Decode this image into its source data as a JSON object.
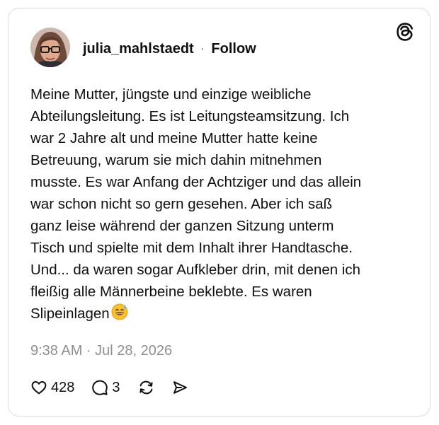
{
  "post": {
    "username": "julia_mahlstaedt",
    "separator": "·",
    "follow_label": "Follow",
    "text_lines": [
      "Meine Mutter, jüngste und einzige weibliche",
      "Abteilungsleitung. Es ist Leitungsteamsitzung. Ich",
      "war 2 Jahre alt und meine Mutter hatte keine",
      "Betreuung, warum sie mich dahin mitnehmen",
      "musste. Es war Anfang der Achtziger und das allein",
      "war schon nicht so gern gesehen. Aber ich saß",
      "ganz leise während der ganzen Sitzung unterm",
      "Tisch und spielte mit dem Inhalt ihrer Handtasche.",
      "Und... da waren sogar Aufkleber drin, mit denen ich",
      "fleißig alle Männerbeine beklebte. Es waren",
      "Slipeinlagen"
    ],
    "emoji": "grinning-face-with-sweat",
    "timestamp": "9:38 AM · Jul 28, 2026",
    "likes": "428",
    "replies": "3"
  },
  "icons": {
    "brand": "threads-logo-icon",
    "like": "heart-icon",
    "reply": "speech-bubble-icon",
    "repost": "repost-icon",
    "share": "send-icon"
  },
  "colors": {
    "text": "#101010",
    "muted": "#8f8f8f",
    "border": "#dcdcdc",
    "background": "#ffffff"
  }
}
